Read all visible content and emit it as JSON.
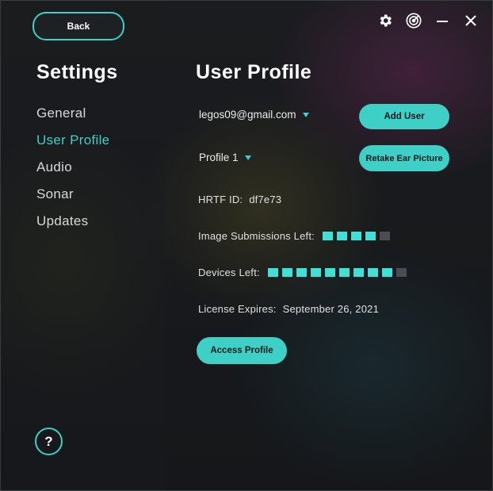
{
  "back_label": "Back",
  "sidebar": {
    "title": "Settings",
    "items": [
      {
        "label": "General",
        "active": false
      },
      {
        "label": "User Profile",
        "active": true
      },
      {
        "label": "Audio",
        "active": false
      },
      {
        "label": "Sonar",
        "active": false
      },
      {
        "label": "Updates",
        "active": false
      }
    ],
    "help_label": "?"
  },
  "window_controls": {
    "icons": [
      "gear-icon",
      "radar-icon",
      "minimize-icon",
      "close-icon"
    ]
  },
  "main": {
    "title": "User Profile",
    "account_dropdown": "legos09@gmail.com",
    "profile_dropdown": "Profile 1",
    "add_user_label": "Add User",
    "retake_label": "Retake Ear Picture",
    "hrtf": {
      "label": "HRTF ID:",
      "value": "df7e73"
    },
    "image_submissions": {
      "label": "Image Submissions Left:",
      "filled": 4,
      "total": 5
    },
    "devices": {
      "label": "Devices Left:",
      "filled": 9,
      "total": 10
    },
    "license": {
      "label": "License Expires:",
      "value": "September 26, 2021"
    },
    "access_label": "Access Profile"
  },
  "colors": {
    "accent": "#3ecfc7",
    "indicator_on": "#3fe0d6",
    "indicator_off": "#4a4d52"
  }
}
